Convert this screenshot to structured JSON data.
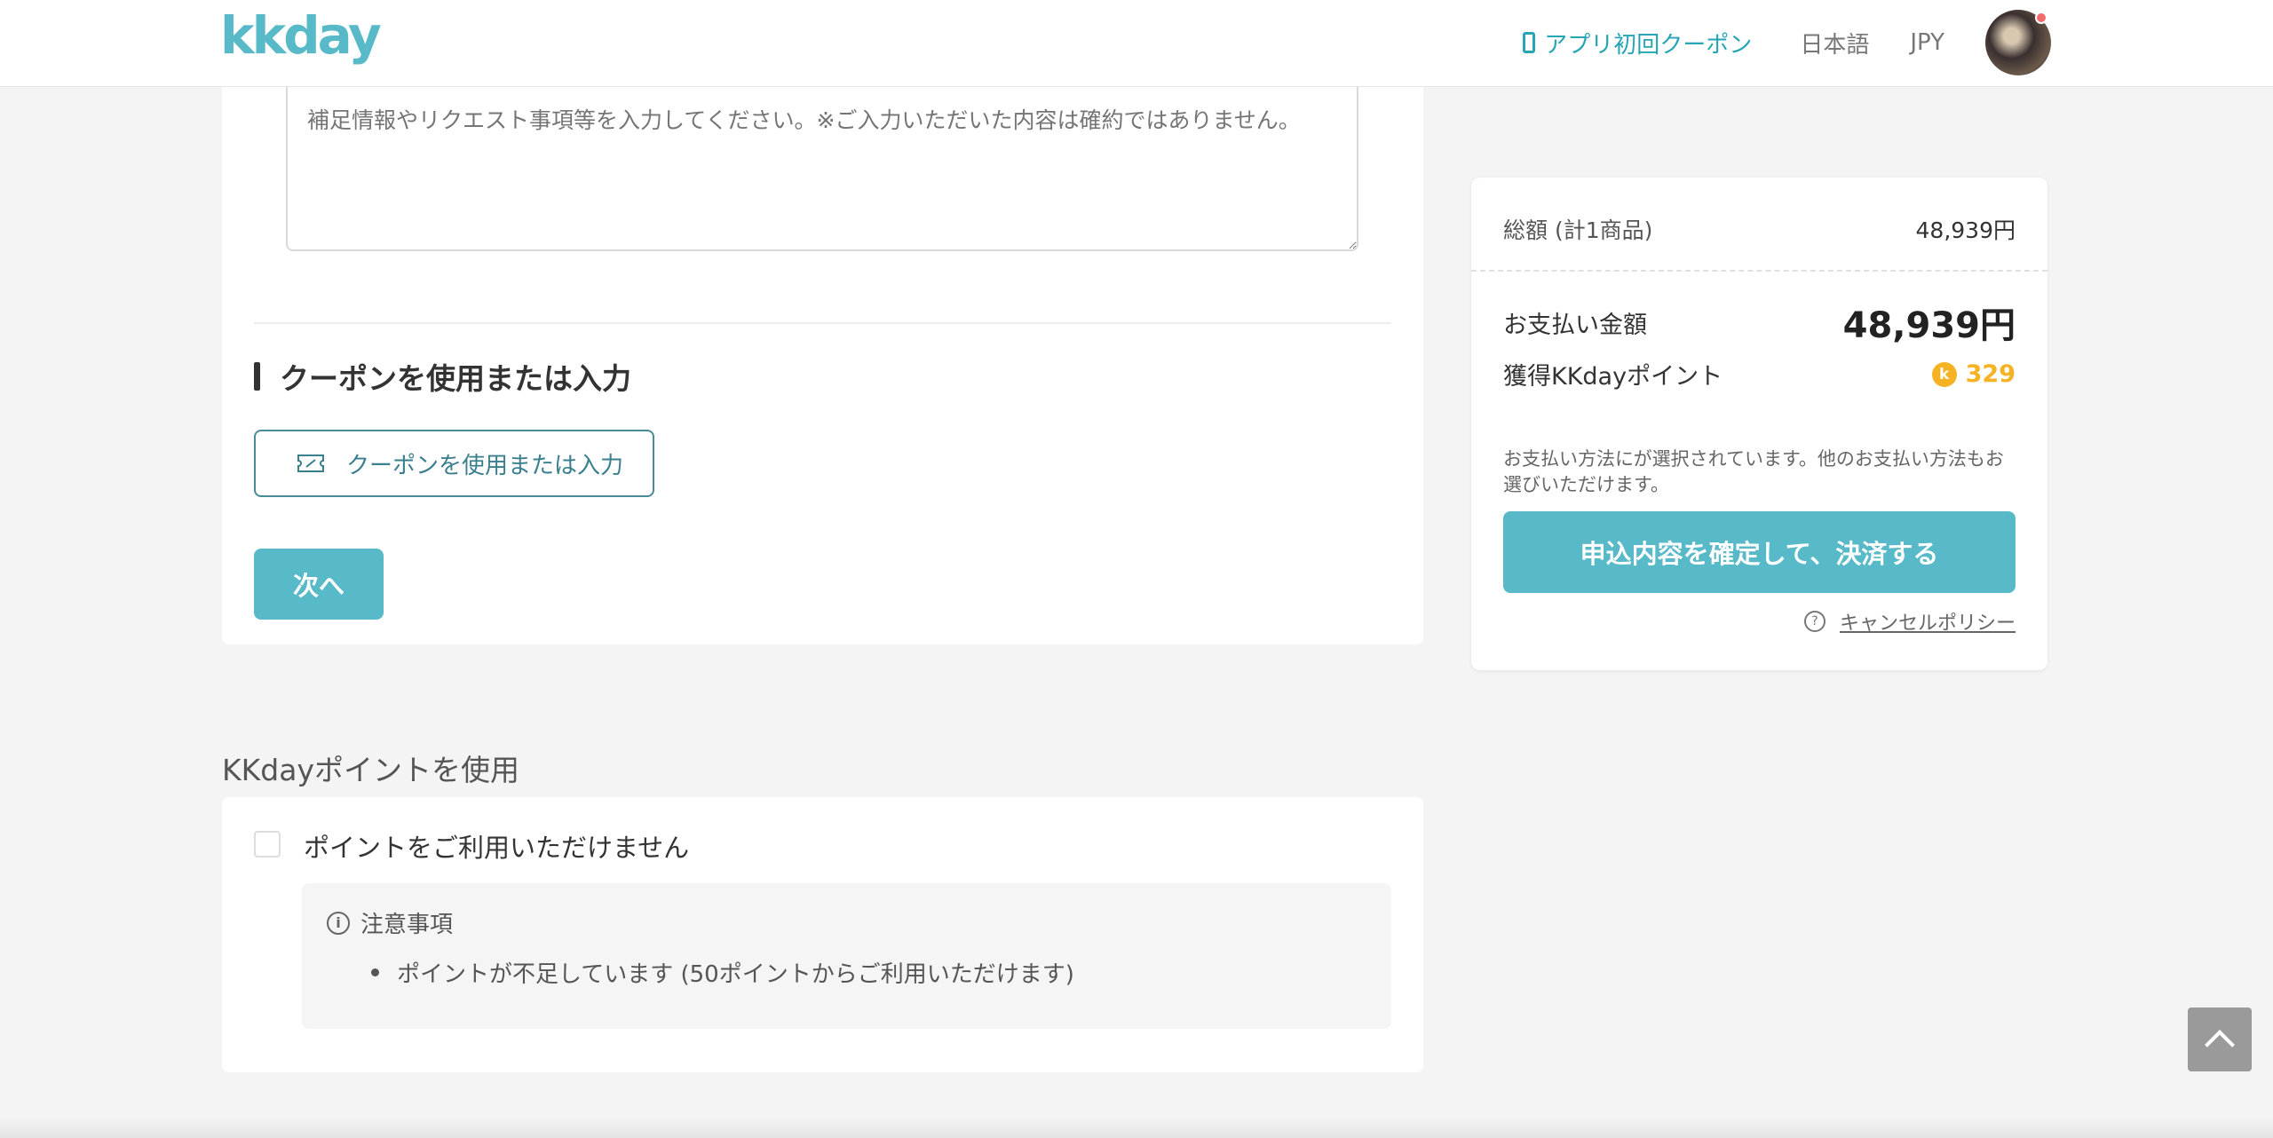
{
  "header": {
    "logo_text": "kkday",
    "app_coupon": "アプリ初回クーポン",
    "language": "日本語",
    "currency": "JPY"
  },
  "main": {
    "textarea_placeholder": "補足情報やリクエスト事項等を入力してください。※ご入力いただいた内容は確約ではありません。",
    "coupon_section_title": "クーポンを使用または入力",
    "coupon_button": "クーポンを使用または入力",
    "next_button": "次へ"
  },
  "points": {
    "heading": "KKdayポイントを使用",
    "checkbox_label": "ポイントをご利用いただけません",
    "notice_title": "注意事項",
    "notice_items": [
      "ポイントが不足しています (50ポイントからご利用いただけます)"
    ]
  },
  "summary": {
    "total_label": "総額 (計1商品)",
    "total_value": "48,939円",
    "payment_label": "お支払い金額",
    "payment_value": "48,939円",
    "points_label": "獲得KKdayポイント",
    "points_value": "329",
    "points_coin": "k",
    "payment_note": "お支払い方法にが選択されています。他のお支払い方法もお選びいただけます。",
    "confirm_button": "申込内容を確定して、決済する",
    "cancel_policy": "キャンセルポリシー"
  },
  "colors": {
    "brand": "#58b9c8",
    "brand_dark": "#26a5b5",
    "points_gold": "#f5b223"
  }
}
